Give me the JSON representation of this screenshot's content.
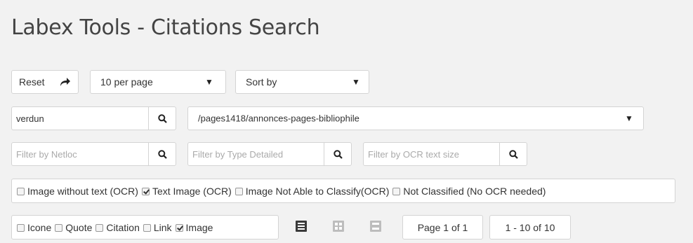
{
  "page": {
    "title": "Labex Tools - Citations Search"
  },
  "toolbar": {
    "reset_label": "Reset",
    "reset_icon": "share-arrow-icon",
    "per_page_label": "10 per page",
    "sort_label": "Sort by"
  },
  "search": {
    "query_value": "verdun",
    "path_value": "/pages1418/annonces-pages-bibliophile",
    "netloc_placeholder": "Filter by Netloc",
    "type_placeholder": "Filter by Type Detailed",
    "ocr_placeholder": "Filter by OCR text size"
  },
  "ocr_filters": [
    {
      "label": "Image without text (OCR)",
      "checked": false
    },
    {
      "label": "Text Image (OCR)",
      "checked": true
    },
    {
      "label": "Image Not Able to Classify(OCR)",
      "checked": false
    },
    {
      "label": "Not Classified (No OCR needed)",
      "checked": false
    }
  ],
  "type_filters": [
    {
      "label": "Icone",
      "checked": false
    },
    {
      "label": "Quote",
      "checked": false
    },
    {
      "label": "Citation",
      "checked": false
    },
    {
      "label": "Link",
      "checked": false
    },
    {
      "label": "Image",
      "checked": true
    }
  ],
  "pagination": {
    "page_label": "Page 1 of 1",
    "range_label": "1 - 10 of 10"
  },
  "colors": {
    "accent_icon": "#3a3a3a",
    "muted_icon": "#bdbdbd"
  }
}
